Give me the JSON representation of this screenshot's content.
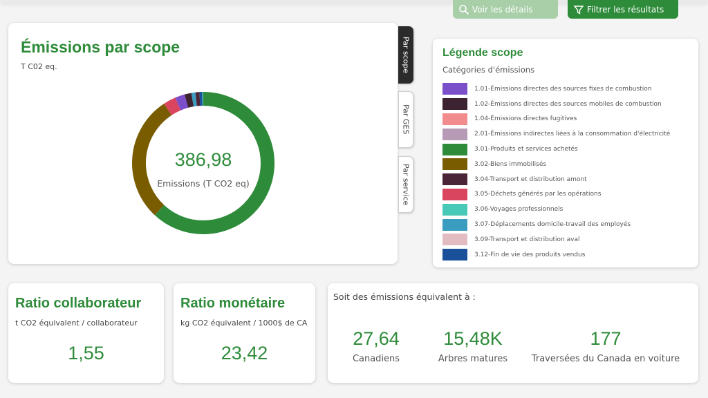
{
  "header": {
    "details_label": "Voir les détails",
    "filter_label": "Filtrer les résultats"
  },
  "tabs": [
    {
      "label": "Par scope",
      "active": true
    },
    {
      "label": "Par GES",
      "active": false
    },
    {
      "label": "Par service",
      "active": false
    }
  ],
  "chart_data": {
    "type": "pie",
    "title": "Émissions par scope",
    "subtitle": "T C02 eq.",
    "center_value": "386,98",
    "center_label": "Emissions (T CO2 eq)",
    "total": 386.98,
    "categories": [
      "3.01-Produits et services achetés",
      "3.02-Biens immobilisés",
      "3.05-Déchets générés par les opérations",
      "1.01-Émissions directes des sources fixes de combustion",
      "1.02-Émissions directes des sources mobiles de combustion",
      "3.07-Déplacements domicile-travail des employés",
      "3.04-Transport et distribution amont",
      "3.12-Fin de vie des produits vendus",
      "3.06-Voyages professionnels"
    ],
    "values": [
      239.0,
      111.0,
      11.0,
      8.5,
      6.0,
      3.5,
      3.5,
      2.5,
      1.0
    ],
    "colors": [
      "#2e8b3a",
      "#7a5c00",
      "#d9455f",
      "#7b4fc9",
      "#3d2230",
      "#3a9cbf",
      "#4a2538",
      "#1a4f99",
      "#48c9b8"
    ]
  },
  "legend": {
    "title": "Légende scope",
    "subtitle": "Catégories d'émissions",
    "items": [
      {
        "label": "1.01-Émissions directes des sources fixes de combustion",
        "color": "#7b4fc9"
      },
      {
        "label": "1.02-Émissions directes des sources mobiles de combustion",
        "color": "#3d2230"
      },
      {
        "label": "1.04-Émissions directes fugitives",
        "color": "#f28b8b"
      },
      {
        "label": "2.01-Émissions indirectes liées à la consommation d'électricité",
        "color": "#b79ab5"
      },
      {
        "label": "3.01-Produits et services achetés",
        "color": "#2e8b3a"
      },
      {
        "label": "3.02-Biens immobilisés",
        "color": "#7a5c00"
      },
      {
        "label": "3.04-Transport et distribution amont",
        "color": "#4a2538"
      },
      {
        "label": "3.05-Déchets générés par les opérations",
        "color": "#d9455f"
      },
      {
        "label": "3.06-Voyages professionnels",
        "color": "#48c9b8"
      },
      {
        "label": "3.07-Déplacements domicile-travail des employés",
        "color": "#3a9cbf"
      },
      {
        "label": "3.09-Transport et distribution aval",
        "color": "#e2bcc1"
      },
      {
        "label": "3.12-Fin de vie des produits vendus",
        "color": "#1a4f99"
      }
    ]
  },
  "ratio_collaborateur": {
    "title": "Ratio collaborateur",
    "unit": "t CO2 équivalent / collaborateur",
    "value": "1,55"
  },
  "ratio_monetaire": {
    "title": "Ratio monétaire",
    "unit": "kg CO2 équivalent / 1000$ de CA",
    "value": "23,42"
  },
  "equivalents": {
    "title": "Soit des émissions équivalent à :",
    "items": [
      {
        "value": "27,64",
        "label": "Canadiens"
      },
      {
        "value": "15,48K",
        "label": "Arbres matures"
      },
      {
        "value": "177",
        "label": "Traversées du Canada en voiture"
      }
    ]
  },
  "colors": {
    "accent": "#2e8b3a",
    "accent_light": "#a9cfa9",
    "tab_active": "#2b2b2b"
  }
}
